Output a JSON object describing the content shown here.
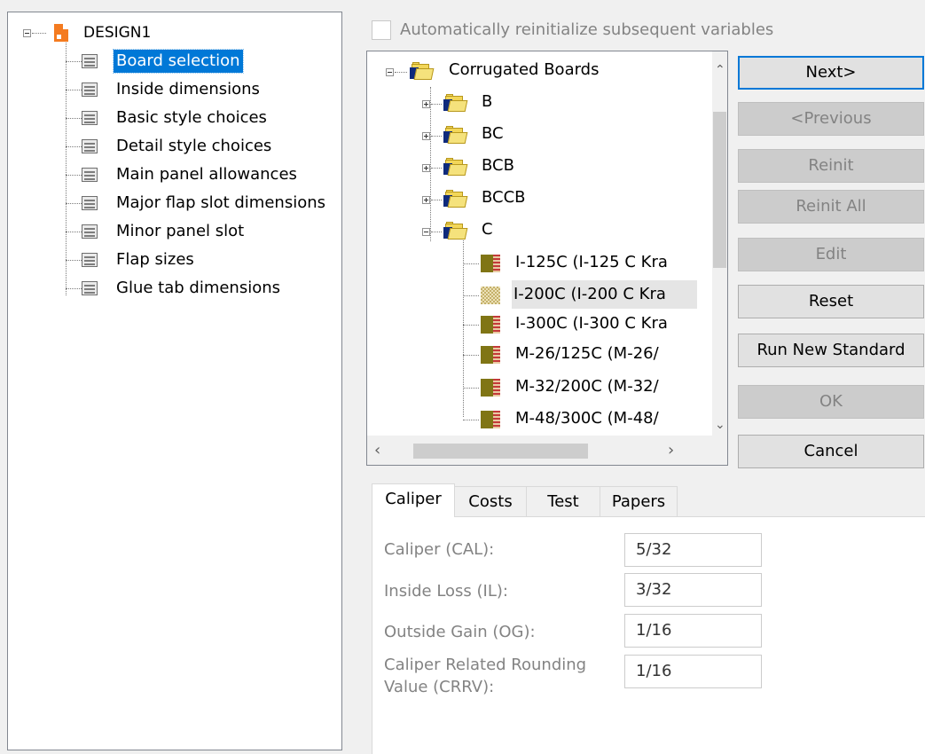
{
  "design_tree": {
    "root_label": "DESIGN1",
    "items": [
      {
        "label": "Board selection",
        "selected": true
      },
      {
        "label": "Inside dimensions"
      },
      {
        "label": "Basic style choices"
      },
      {
        "label": "Detail style choices"
      },
      {
        "label": "Main panel allowances"
      },
      {
        "label": "Major flap slot dimensions"
      },
      {
        "label": "Minor panel slot"
      },
      {
        "label": "Flap sizes"
      },
      {
        "label": "Glue tab dimensions"
      }
    ]
  },
  "auto_reinit": {
    "label": "Automatically reinitialize subsequent variables",
    "checked": false,
    "enabled": false
  },
  "board_tree": {
    "root": "Corrugated Boards",
    "folders": [
      "B",
      "BC",
      "BCB",
      "BCCB",
      "C"
    ],
    "boards": [
      {
        "label": "I-125C (I-125 C Kra"
      },
      {
        "label": "I-200C (I-200 C Kra",
        "highlighted": true
      },
      {
        "label": "I-300C (I-300 C Kra"
      },
      {
        "label": "M-26/125C (M-26/"
      },
      {
        "label": "M-32/200C (M-32/"
      },
      {
        "label": "M-48/300C (M-48/"
      }
    ]
  },
  "buttons": {
    "next": "Next>",
    "previous": "<Previous",
    "reinit": "Reinit",
    "reinit_all": "Reinit All",
    "edit": "Edit",
    "reset": "Reset",
    "run_new_standard": "Run New Standard",
    "ok": "OK",
    "cancel": "Cancel"
  },
  "tabs": [
    "Caliper",
    "Costs",
    "Test",
    "Papers"
  ],
  "active_tab": "Caliper",
  "caliper": {
    "fields": [
      {
        "label": "Caliper (CAL):",
        "value": "5/32"
      },
      {
        "label": "Inside Loss (IL):",
        "value": "3/32"
      },
      {
        "label": "Outside Gain (OG):",
        "value": "1/16"
      },
      {
        "label_line1": "Caliper Related Rounding",
        "label_line2": "Value (CRRV):",
        "value": "1/16"
      }
    ]
  },
  "colors": {
    "selection": "#0078d7",
    "disabled_text": "#838383",
    "window_bg": "#f0f0f0"
  }
}
